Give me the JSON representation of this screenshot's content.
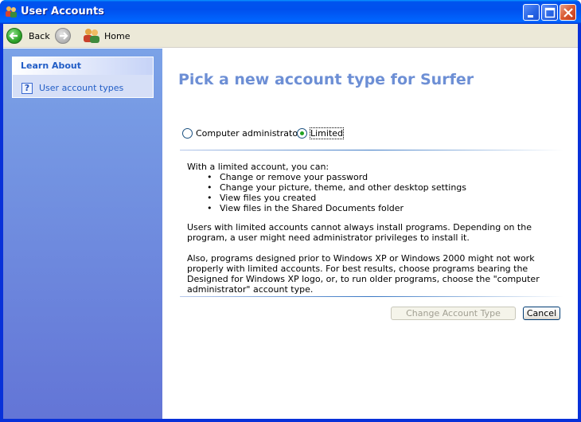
{
  "window": {
    "title": "User Accounts"
  },
  "toolbar": {
    "back_label": "Back",
    "home_label": "Home"
  },
  "left": {
    "section_title": "Learn About",
    "items": [
      {
        "label": "User account types"
      }
    ]
  },
  "main": {
    "heading": "Pick a new account type for Surfer",
    "options": [
      {
        "label": "Computer administrator",
        "selected": false
      },
      {
        "label": "Limited",
        "selected": true
      }
    ],
    "intro": "With a limited account, you can:",
    "bullets": [
      "Change or remove your password",
      "Change your picture, theme, and other desktop settings",
      "View files you created",
      "View files in the Shared Documents folder"
    ],
    "para1": "Users with limited accounts cannot always install programs. Depending on the program, a user might need administrator privileges to install it.",
    "para2": "Also, programs designed prior to Windows XP or Windows 2000 might not work properly with limited accounts. For best results, choose programs bearing the Designed for Windows XP logo, or, to run older programs, choose the \"computer administrator\" account type.",
    "change_button": "Change Account Type",
    "cancel_button": "Cancel"
  },
  "colors": {
    "heading": "#6d8fd5",
    "link": "#215dc6",
    "titlebar": "#0050ee"
  }
}
